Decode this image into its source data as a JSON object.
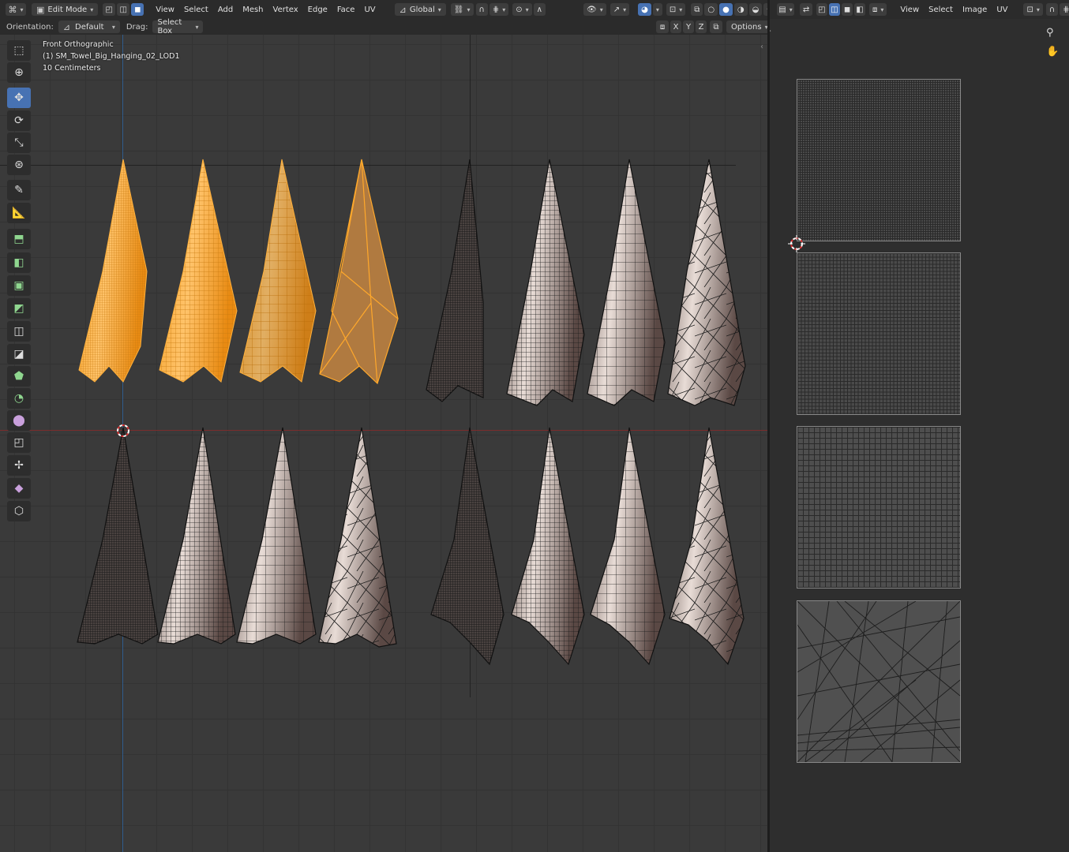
{
  "viewport_header": {
    "mode": "Edit Mode",
    "menus": [
      "View",
      "Select",
      "Add",
      "Mesh",
      "Vertex",
      "Edge",
      "Face",
      "UV"
    ],
    "transform_orientation": "Global"
  },
  "tool_settings": {
    "orientation_label": "Orientation:",
    "orientation_value": "Default",
    "drag_label": "Drag:",
    "drag_value": "Select Box",
    "axes": [
      "X",
      "Y",
      "Z"
    ],
    "options_label": "Options"
  },
  "viewport_overlay": {
    "view_name": "Front Orthographic",
    "object_name": "(1) SM_Towel_Big_Hanging_02_LOD1",
    "scale": "10 Centimeters"
  },
  "uv_header": {
    "menus": [
      "View",
      "Select",
      "Image",
      "UV"
    ]
  },
  "colors": {
    "selected_orange": "#ffa82b",
    "mesh_cloth": "#b9a49c",
    "active_blue": "#4772b3",
    "viewport_bg": "#3a3a3a"
  },
  "toolbar_icons": [
    "select-box-icon",
    "cursor-icon",
    "move-icon",
    "rotate-icon",
    "scale-icon",
    "transform-icon",
    "annotate-icon",
    "measure-icon",
    "add-cube-icon",
    "extrude-icon",
    "inset-icon",
    "bevel-icon",
    "loop-cut-icon",
    "knife-icon",
    "poly-build-icon",
    "spin-icon",
    "smooth-icon",
    "edge-slide-icon",
    "shrink-fatten-icon",
    "shear-icon",
    "rip-icon"
  ]
}
